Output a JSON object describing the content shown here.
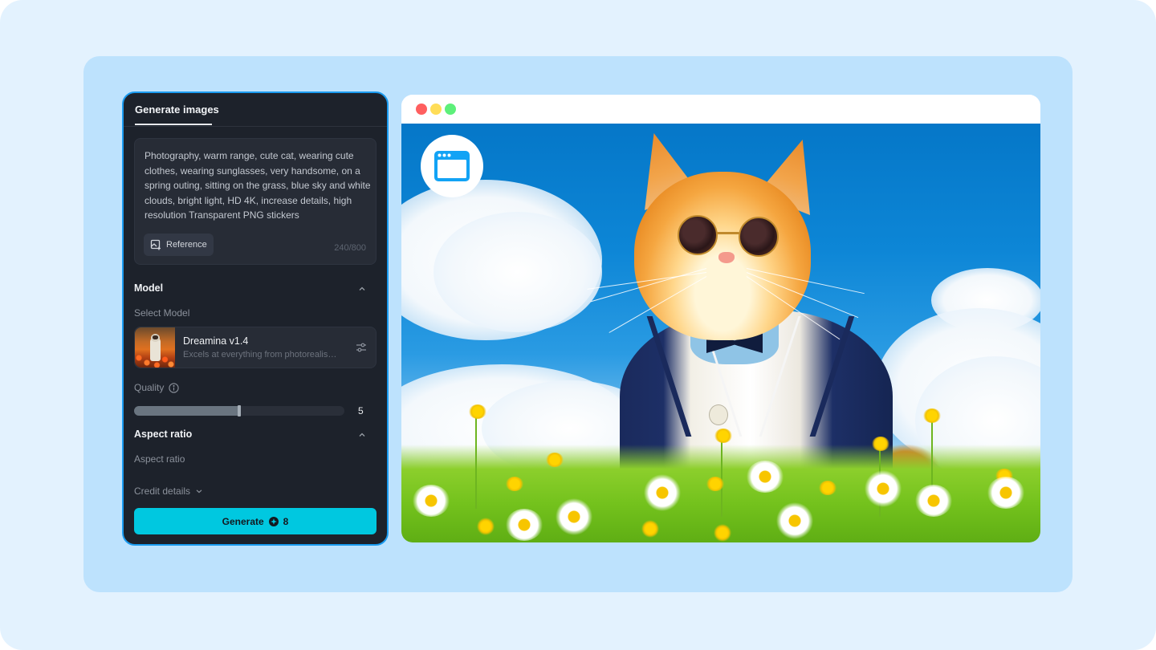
{
  "generator": {
    "tab_label": "Generate images",
    "prompt": {
      "value": "Photography, warm range, cute cat, wearing cute clothes, wearing sunglasses, very handsome, on a spring outing, sitting on the grass, blue sky and white clouds, bright light, HD 4K, increase details, high resolution Transparent PNG stickers",
      "char_count": "240/800",
      "reference_label": "Reference",
      "reference_icon": "image-add-icon"
    },
    "model_section": {
      "title": "Model",
      "select_label": "Select Model",
      "selected_model": {
        "name": "Dreamina v1.4",
        "description": "Excels at everything from photorealism to painterly style",
        "settings_icon": "sliders-icon"
      },
      "quality": {
        "label": "Quality",
        "info_icon": "info-icon",
        "value": "5",
        "min": 0,
        "max": 10
      }
    },
    "aspect_section": {
      "title": "Aspect ratio",
      "label": "Aspect ratio"
    },
    "credit_details_label": "Credit details",
    "generate_button": {
      "label": "Generate",
      "credit_icon": "credit-coin-icon",
      "cost": "8"
    }
  },
  "preview": {
    "window_controls": [
      "close",
      "minimize",
      "maximize"
    ],
    "badge_icon": "browser-window-icon",
    "image_description": "Orange cat wearing round sunglasses and a navy striped cardigan sitting in a flower meadow under a blue sky with white clouds"
  },
  "colors": {
    "accent": "#00c8e0",
    "panel_border": "#1a9bf0",
    "panel_bg": "#1d222b",
    "outer_bg": "#e3f2fe",
    "inner_bg": "#bde2fd"
  }
}
